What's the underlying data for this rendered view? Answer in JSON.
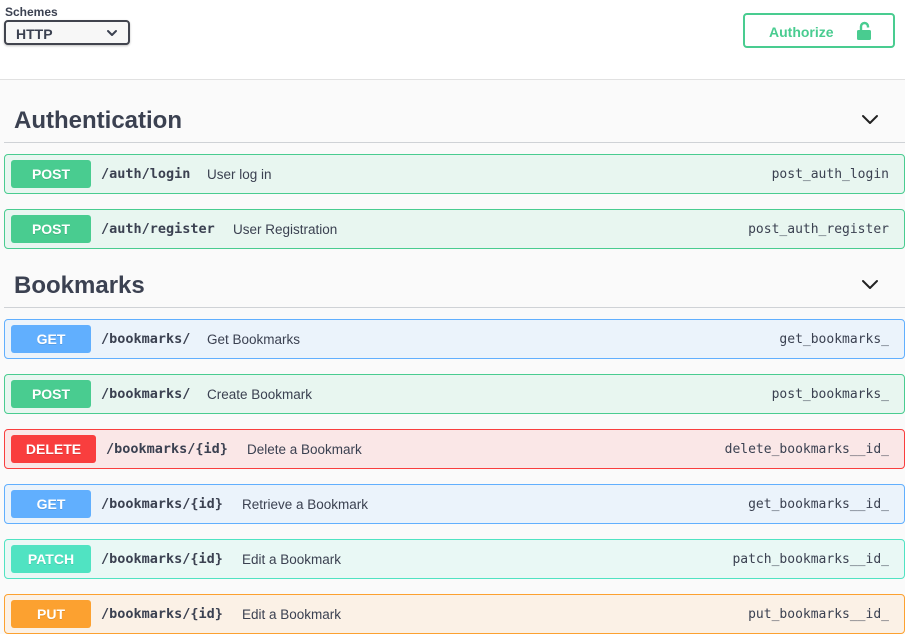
{
  "topbar": {
    "schemes_label": "Schemes",
    "scheme_selected": "HTTP",
    "authorize_label": "Authorize"
  },
  "colors": {
    "post": "#49cc90",
    "get": "#61affe",
    "delete": "#f93e3e",
    "patch": "#50e3c2",
    "put": "#fca130"
  },
  "sections": [
    {
      "title": "Authentication",
      "operations": [
        {
          "method": "POST",
          "path": "/auth/login",
          "summary": "User log in",
          "operation_id": "post_auth_login"
        },
        {
          "method": "POST",
          "path": "/auth/register",
          "summary": "User Registration",
          "operation_id": "post_auth_register"
        }
      ]
    },
    {
      "title": "Bookmarks",
      "operations": [
        {
          "method": "GET",
          "path": "/bookmarks/",
          "summary": "Get Bookmarks",
          "operation_id": "get_bookmarks_"
        },
        {
          "method": "POST",
          "path": "/bookmarks/",
          "summary": "Create Bookmark",
          "operation_id": "post_bookmarks_"
        },
        {
          "method": "DELETE",
          "path": "/bookmarks/{id}",
          "summary": "Delete a Bookmark",
          "operation_id": "delete_bookmarks__id_"
        },
        {
          "method": "GET",
          "path": "/bookmarks/{id}",
          "summary": "Retrieve a Bookmark",
          "operation_id": "get_bookmarks__id_"
        },
        {
          "method": "PATCH",
          "path": "/bookmarks/{id}",
          "summary": "Edit a Bookmark",
          "operation_id": "patch_bookmarks__id_"
        },
        {
          "method": "PUT",
          "path": "/bookmarks/{id}",
          "summary": "Edit a Bookmark",
          "operation_id": "put_bookmarks__id_"
        }
      ]
    }
  ]
}
